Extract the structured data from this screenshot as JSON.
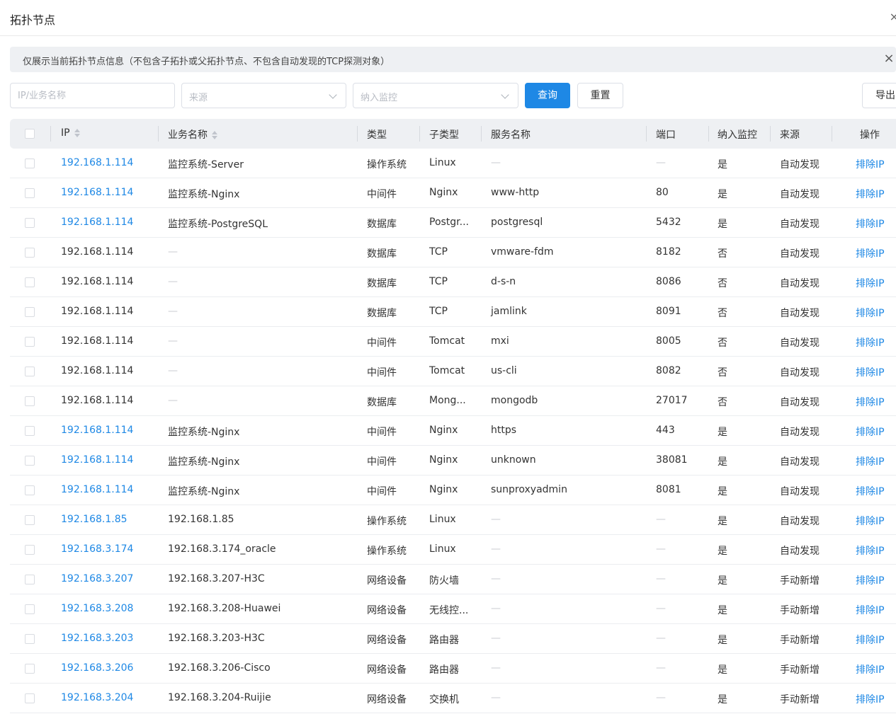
{
  "header": {
    "title": "拓扑节点",
    "close_icon": "close-icon"
  },
  "notice": {
    "text": "仅展示当前拓扑节点信息（不包含子拓扑或父拓扑节点、不包含自动发现的TCP探测对象）",
    "close_icon": "close-icon"
  },
  "filters": {
    "search_placeholder": "IP/业务名称",
    "source_placeholder": "来源",
    "monitor_placeholder": "纳入监控",
    "query_label": "查询",
    "reset_label": "重置",
    "export_label": "导出"
  },
  "colors": {
    "accent": "#1e88e5",
    "header_bg": "#eef0f3"
  },
  "table": {
    "columns": [
      "IP",
      "业务名称",
      "类型",
      "子类型",
      "服务名称",
      "端口",
      "纳入监控",
      "来源",
      "操作"
    ],
    "rows": [
      {
        "ip": "192.168.1.114",
        "link": true,
        "name": "监控系统-Server",
        "type": "操作系统",
        "subtype": "Linux",
        "service": "—",
        "port": "—",
        "monitored": "是",
        "source": "自动发现",
        "action": "排除IP"
      },
      {
        "ip": "192.168.1.114",
        "link": true,
        "name": "监控系统-Nginx",
        "type": "中间件",
        "subtype": "Nginx",
        "service": "www-http",
        "port": "80",
        "monitored": "是",
        "source": "自动发现",
        "action": "排除IP"
      },
      {
        "ip": "192.168.1.114",
        "link": true,
        "name": "监控系统-PostgreSQL",
        "type": "数据库",
        "subtype": "Postgr...",
        "service": "postgresql",
        "port": "5432",
        "monitored": "是",
        "source": "自动发现",
        "action": "排除IP"
      },
      {
        "ip": "192.168.1.114",
        "link": false,
        "name": "—",
        "type": "数据库",
        "subtype": "TCP",
        "service": "vmware-fdm",
        "port": "8182",
        "monitored": "否",
        "source": "自动发现",
        "action": "排除IP"
      },
      {
        "ip": "192.168.1.114",
        "link": false,
        "name": "—",
        "type": "数据库",
        "subtype": "TCP",
        "service": "d-s-n",
        "port": "8086",
        "monitored": "否",
        "source": "自动发现",
        "action": "排除IP"
      },
      {
        "ip": "192.168.1.114",
        "link": false,
        "name": "—",
        "type": "数据库",
        "subtype": "TCP",
        "service": "jamlink",
        "port": "8091",
        "monitored": "否",
        "source": "自动发现",
        "action": "排除IP"
      },
      {
        "ip": "192.168.1.114",
        "link": false,
        "name": "—",
        "type": "中间件",
        "subtype": "Tomcat",
        "service": "mxi",
        "port": "8005",
        "monitored": "否",
        "source": "自动发现",
        "action": "排除IP"
      },
      {
        "ip": "192.168.1.114",
        "link": false,
        "name": "—",
        "type": "中间件",
        "subtype": "Tomcat",
        "service": "us-cli",
        "port": "8082",
        "monitored": "否",
        "source": "自动发现",
        "action": "排除IP"
      },
      {
        "ip": "192.168.1.114",
        "link": false,
        "name": "—",
        "type": "数据库",
        "subtype": "Mong...",
        "service": "mongodb",
        "port": "27017",
        "monitored": "否",
        "source": "自动发现",
        "action": "排除IP"
      },
      {
        "ip": "192.168.1.114",
        "link": true,
        "name": "监控系统-Nginx",
        "type": "中间件",
        "subtype": "Nginx",
        "service": "https",
        "port": "443",
        "monitored": "是",
        "source": "自动发现",
        "action": "排除IP"
      },
      {
        "ip": "192.168.1.114",
        "link": true,
        "name": "监控系统-Nginx",
        "type": "中间件",
        "subtype": "Nginx",
        "service": "unknown",
        "port": "38081",
        "monitored": "是",
        "source": "自动发现",
        "action": "排除IP"
      },
      {
        "ip": "192.168.1.114",
        "link": true,
        "name": "监控系统-Nginx",
        "type": "中间件",
        "subtype": "Nginx",
        "service": "sunproxyadmin",
        "port": "8081",
        "monitored": "是",
        "source": "自动发现",
        "action": "排除IP"
      },
      {
        "ip": "192.168.1.85",
        "link": true,
        "name": "192.168.1.85",
        "type": "操作系统",
        "subtype": "Linux",
        "service": "—",
        "port": "—",
        "monitored": "是",
        "source": "自动发现",
        "action": "排除IP"
      },
      {
        "ip": "192.168.3.174",
        "link": true,
        "name": "192.168.3.174_oracle",
        "type": "操作系统",
        "subtype": "Linux",
        "service": "—",
        "port": "—",
        "monitored": "是",
        "source": "自动发现",
        "action": "排除IP"
      },
      {
        "ip": "192.168.3.207",
        "link": true,
        "name": "192.168.3.207-H3C",
        "type": "网络设备",
        "subtype": "防火墙",
        "service": "—",
        "port": "—",
        "monitored": "是",
        "source": "手动新增",
        "action": "排除IP"
      },
      {
        "ip": "192.168.3.208",
        "link": true,
        "name": "192.168.3.208-Huawei",
        "type": "网络设备",
        "subtype": "无线控...",
        "service": "—",
        "port": "—",
        "monitored": "是",
        "source": "手动新增",
        "action": "排除IP"
      },
      {
        "ip": "192.168.3.203",
        "link": true,
        "name": "192.168.3.203-H3C",
        "type": "网络设备",
        "subtype": "路由器",
        "service": "—",
        "port": "—",
        "monitored": "是",
        "source": "手动新增",
        "action": "排除IP"
      },
      {
        "ip": "192.168.3.206",
        "link": true,
        "name": "192.168.3.206-Cisco",
        "type": "网络设备",
        "subtype": "路由器",
        "service": "—",
        "port": "—",
        "monitored": "是",
        "source": "手动新增",
        "action": "排除IP"
      },
      {
        "ip": "192.168.3.204",
        "link": true,
        "name": "192.168.3.204-Ruijie",
        "type": "网络设备",
        "subtype": "交换机",
        "service": "—",
        "port": "—",
        "monitored": "是",
        "source": "手动新增",
        "action": "排除IP"
      }
    ]
  }
}
